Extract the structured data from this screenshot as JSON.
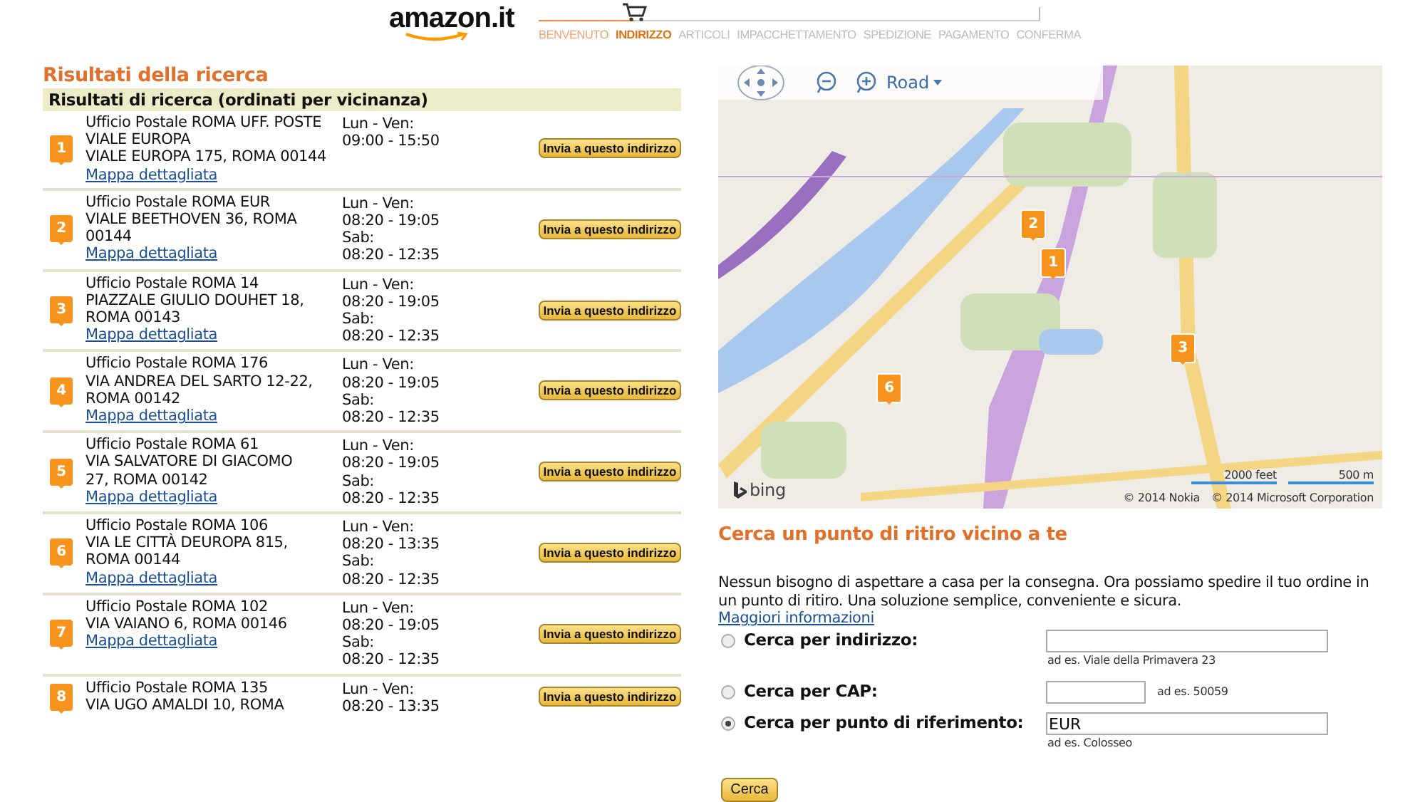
{
  "header": {
    "logo": "amazon.it",
    "progress": {
      "level": 0.19
    },
    "steps": [
      {
        "label": "BENVENUTO",
        "completed": true,
        "selected": false
      },
      {
        "label": "INDIRIZZO",
        "completed": false,
        "selected": true
      },
      {
        "label": "ARTICOLI",
        "completed": false,
        "selected": false
      },
      {
        "label": "IMPACCHETTAMENTO",
        "completed": false,
        "selected": false
      },
      {
        "label": "SPEDIZIONE",
        "completed": false,
        "selected": false
      },
      {
        "label": "PAGAMENTO",
        "completed": false,
        "selected": false
      },
      {
        "label": "CONFERMA",
        "completed": false,
        "selected": false
      }
    ]
  },
  "results": {
    "title": "Risultati della ricerca",
    "subtitle": "Risultati di ricerca (ordinati per vicinanza)",
    "items": [
      {
        "marker": "1",
        "lines": [
          "Ufficio Postale ROMA UFF. POSTE",
          "VIALE EUROPA",
          "VIALE EUROPA 175, ROMA 00144"
        ],
        "link": "Mappa dettagliata",
        "hours": [
          "Lun - Ven:",
          "09:00 - 15:50"
        ],
        "button": "Invia a questo indirizzo"
      },
      {
        "marker": "2",
        "lines": [
          "Ufficio Postale ROMA EUR",
          "VIALE BEETHOVEN 36, ROMA",
          "00144"
        ],
        "link": "Mappa dettagliata",
        "hours": [
          "Lun - Ven:",
          "08:20 - 19:05",
          "Sab:",
          "08:20 - 12:35"
        ],
        "button": "Invia a questo indirizzo"
      },
      {
        "marker": "3",
        "lines": [
          "Ufficio Postale ROMA 14",
          "PIAZZALE GIULIO DOUHET 18,",
          "ROMA 00143"
        ],
        "link": "Mappa dettagliata",
        "hours": [
          "Lun - Ven:",
          "08:20 - 19:05",
          "Sab:",
          "08:20 - 12:35"
        ],
        "button": "Invia a questo indirizzo"
      },
      {
        "marker": "4",
        "lines": [
          "Ufficio Postale ROMA 176",
          "VIA ANDREA DEL SARTO 12-22,",
          "ROMA 00142"
        ],
        "link": "Mappa dettagliata",
        "hours": [
          "Lun - Ven:",
          "08:20 - 19:05",
          "Sab:",
          "08:20 - 12:35"
        ],
        "button": "Invia a questo indirizzo"
      },
      {
        "marker": "5",
        "lines": [
          "Ufficio Postale ROMA 61",
          "VIA SALVATORE DI GIACOMO",
          "27, ROMA 00142"
        ],
        "link": "Mappa dettagliata",
        "hours": [
          "Lun - Ven:",
          "08:20 - 19:05",
          "Sab:",
          "08:20 - 12:35"
        ],
        "button": "Invia a questo indirizzo"
      },
      {
        "marker": "6",
        "lines": [
          "Ufficio Postale ROMA 106",
          "VIA LE CITTÀ DEUROPA 815,",
          "ROMA 00144"
        ],
        "link": "Mappa dettagliata",
        "hours": [
          "Lun - Ven:",
          "08:20 - 13:35",
          "Sab:",
          "08:20 - 12:35"
        ],
        "button": "Invia a questo indirizzo"
      },
      {
        "marker": "7",
        "lines": [
          "Ufficio Postale ROMA 102",
          "VIA VAIANO 6, ROMA 00146"
        ],
        "link": "Mappa dettagliata",
        "hours": [
          "Lun - Ven:",
          "08:20 - 19:05",
          "Sab:",
          "08:20 - 12:35"
        ],
        "button": "Invia a questo indirizzo"
      },
      {
        "marker": "8",
        "lines": [
          "Ufficio Postale ROMA 135",
          "VIA UGO AMALDI 10, ROMA"
        ],
        "hours": [
          "Lun - Ven:",
          "08:20 - 13:35"
        ],
        "button": "Invia a questo indirizzo"
      }
    ]
  },
  "map": {
    "view": "Road",
    "pins": [
      "2",
      "1",
      "3",
      "6"
    ],
    "brand": "bing",
    "scale": [
      "2000 feet",
      "500 m"
    ],
    "credits": [
      "© 2014 Nokia",
      "© 2014 Microsoft Corporation"
    ]
  },
  "search": {
    "title": "Cerca un punto di ritiro vicino a te",
    "text": "Nessun bisogno di aspettare a casa per la consegna. Ora possiamo spedire il tuo ordine in un punto di ritiro. Una soluzione semplice, conveniente e sicura.",
    "link": "Maggiori informazioni",
    "options": [
      {
        "label": "Cerca per indirizzo:",
        "kind": "wide",
        "selected": false,
        "hint": "ad es. Viale della Primavera 23"
      },
      {
        "label": "Cerca per CAP:",
        "kind": "short",
        "selected": false,
        "hint": "ad es. 50059"
      },
      {
        "label": "Cerca per punto di riferimento:",
        "kind": "wide",
        "selected": true,
        "value": "EUR",
        "hint": "ad es. Colosseo"
      }
    ],
    "button": "Cerca"
  }
}
